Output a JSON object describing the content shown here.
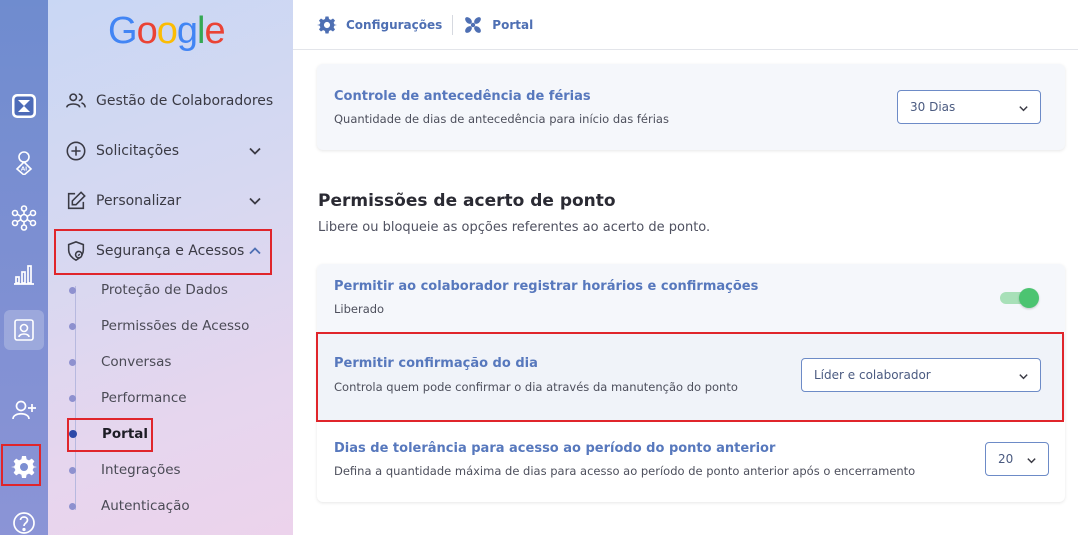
{
  "brand": {
    "logo_letters": [
      "G",
      "o",
      "o",
      "g",
      "l",
      "e"
    ],
    "logo_colors": [
      "#4285F4",
      "#EA4335",
      "#FBBC05",
      "#4285F4",
      "#34A853",
      "#EA4335"
    ]
  },
  "rail": {
    "icons": [
      "hourglass-icon",
      "ai-profile-icon",
      "network-icon",
      "bar-chart-icon",
      "badge-icon",
      "add-user-icon",
      "gear-icon",
      "help-icon"
    ]
  },
  "sidebar": {
    "items": [
      {
        "label": "Gestão de Colaboradores",
        "icon": "users-icon"
      },
      {
        "label": "Solicitações",
        "icon": "plus-circle-icon"
      },
      {
        "label": "Personalizar",
        "icon": "edit-icon"
      },
      {
        "label": "Segurança e Acessos",
        "icon": "shield-icon"
      }
    ],
    "subitems": [
      {
        "label": "Proteção de Dados"
      },
      {
        "label": "Permissões de Acesso"
      },
      {
        "label": "Conversas"
      },
      {
        "label": "Performance"
      },
      {
        "label": "Portal"
      },
      {
        "label": "Integrações"
      },
      {
        "label": "Autenticação"
      }
    ]
  },
  "breadcrumb": {
    "first": "Configurações",
    "second": "Portal"
  },
  "vacation": {
    "title": "Controle de antecedência de férias",
    "desc": "Quantidade de dias de antecedência para início das férias",
    "value": "30 Dias"
  },
  "section": {
    "title": "Permissões de acerto de ponto",
    "desc": "Libere ou bloqueie as opções referentes ao acerto de ponto."
  },
  "register": {
    "title": "Permitir ao colaborador registrar horários e confirmações",
    "status": "Liberado",
    "enabled": true
  },
  "confirm_day": {
    "title": "Permitir confirmação do dia",
    "desc": "Controla quem pode confirmar o dia através da manutenção do ponto",
    "value": "Líder e colaborador"
  },
  "tolerance": {
    "title": "Dias de tolerância para acesso ao período do ponto anterior",
    "desc": "Defina a quantidade máxima de dias para acesso ao período de ponto anterior após o encerramento",
    "value": "20"
  },
  "colors": {
    "accent": "#5778bd",
    "highlight": "#e0252b",
    "toggle_on": "#4cc471"
  }
}
